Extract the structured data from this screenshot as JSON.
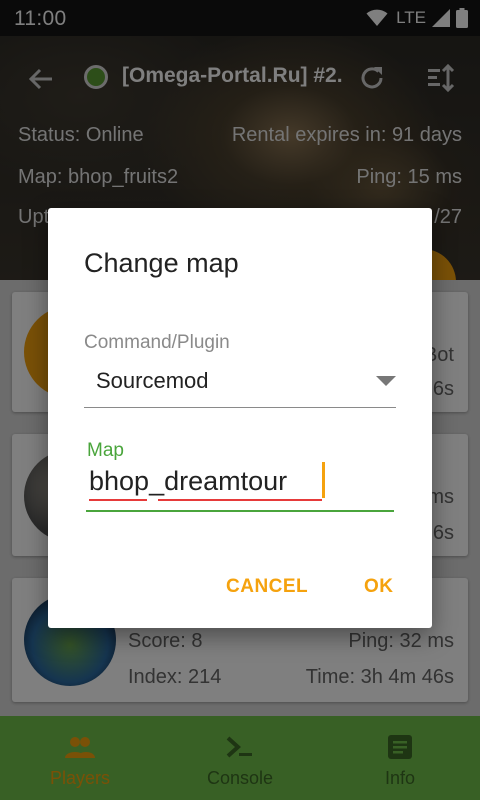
{
  "statusbar": {
    "time": "11:00",
    "network": "LTE"
  },
  "appbar": {
    "title": "[Omega-Portal.Ru] #2..."
  },
  "server": {
    "status": "Status: Online",
    "rental": "Rental expires in: 91 days",
    "map": "Map: bhop_fruits2",
    "ping": "Ping: 15 ms",
    "uptime_partial": "Upt",
    "players_partial": "/27"
  },
  "players": [
    {
      "name_partial": "Bot",
      "time_partial": "6s"
    },
    {
      "ping_partial": "ms",
      "time_partial": "6s"
    },
    {
      "score": "Score: 8",
      "ping": "Ping: 32 ms",
      "index": "Index: 214",
      "time": "Time: 3h 4m 46s"
    }
  ],
  "dialog": {
    "title": "Change map",
    "plugin_label": "Command/Plugin",
    "plugin_value": "Sourcemod",
    "map_label": "Map",
    "map_value": "bhop_dreamtour",
    "cancel": "CANCEL",
    "ok": "OK"
  },
  "nav": {
    "items": [
      {
        "label": "Players",
        "icon": "people-icon",
        "active": true
      },
      {
        "label": "Console",
        "icon": "terminal-icon",
        "active": false
      },
      {
        "label": "Info",
        "icon": "document-icon",
        "active": false
      }
    ]
  },
  "colors": {
    "accent": "#f5a20e",
    "primary": "#71c04a",
    "focus": "#4aa53c"
  }
}
